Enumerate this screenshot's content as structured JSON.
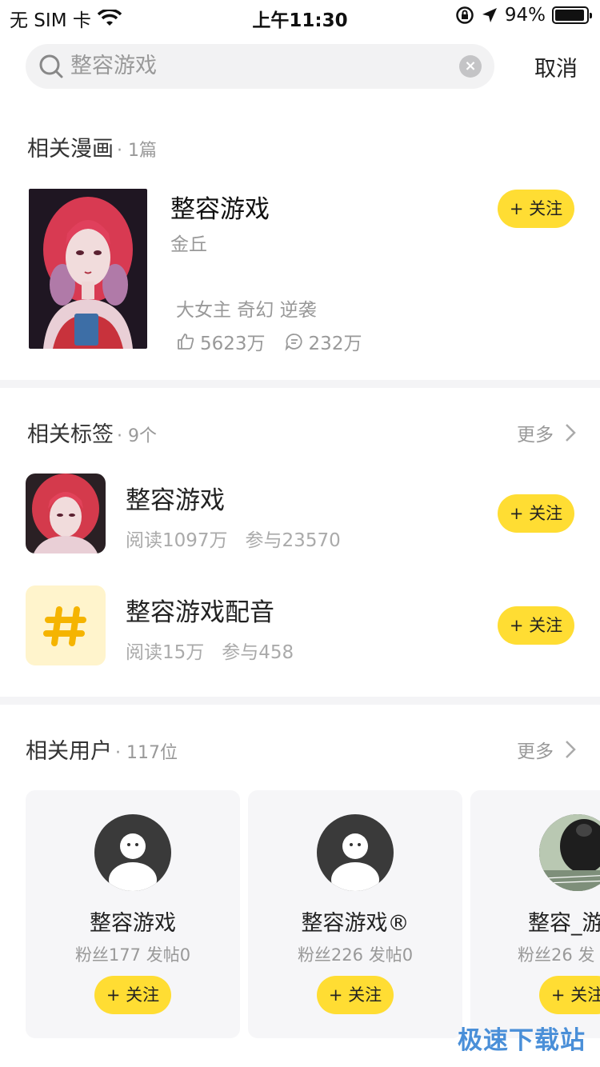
{
  "status_bar": {
    "carrier": "无 SIM 卡",
    "time": "上午11:30",
    "battery": "94%",
    "battery_level": 0.94
  },
  "search": {
    "value": "整容游戏",
    "cancel": "取消"
  },
  "comics": {
    "title": "相关漫画",
    "count": "· 1篇",
    "item": {
      "title": "整容游戏",
      "author": "金丘",
      "tags": "大女主 奇幻 逆袭",
      "likes": "5623万",
      "comments": "232万",
      "follow": "+ 关注"
    }
  },
  "tags": {
    "title": "相关标签",
    "count": "· 9个",
    "more": "更多",
    "items": [
      {
        "name": "整容游戏",
        "reads": "阅读1097万",
        "participants": "参与23570",
        "follow": "+ 关注"
      },
      {
        "name": "整容游戏配音",
        "reads": "阅读15万",
        "participants": "参与458",
        "follow": "+ 关注"
      }
    ]
  },
  "users": {
    "title": "相关用户",
    "count": "· 117位",
    "more": "更多",
    "items": [
      {
        "name": "整容游戏",
        "meta": "粉丝177 发帖0",
        "follow": "+ 关注"
      },
      {
        "name": "整容游戏®",
        "meta": "粉丝226 发帖0",
        "follow": "+ 关注"
      },
      {
        "name": "整容_游",
        "meta": "粉丝26 发",
        "follow": "+ 关注"
      }
    ]
  },
  "watermark": "极速下载站",
  "colors": {
    "accent": "#ffdd33",
    "tag_bg": "#fff4cc",
    "hash": "#f5b400"
  }
}
